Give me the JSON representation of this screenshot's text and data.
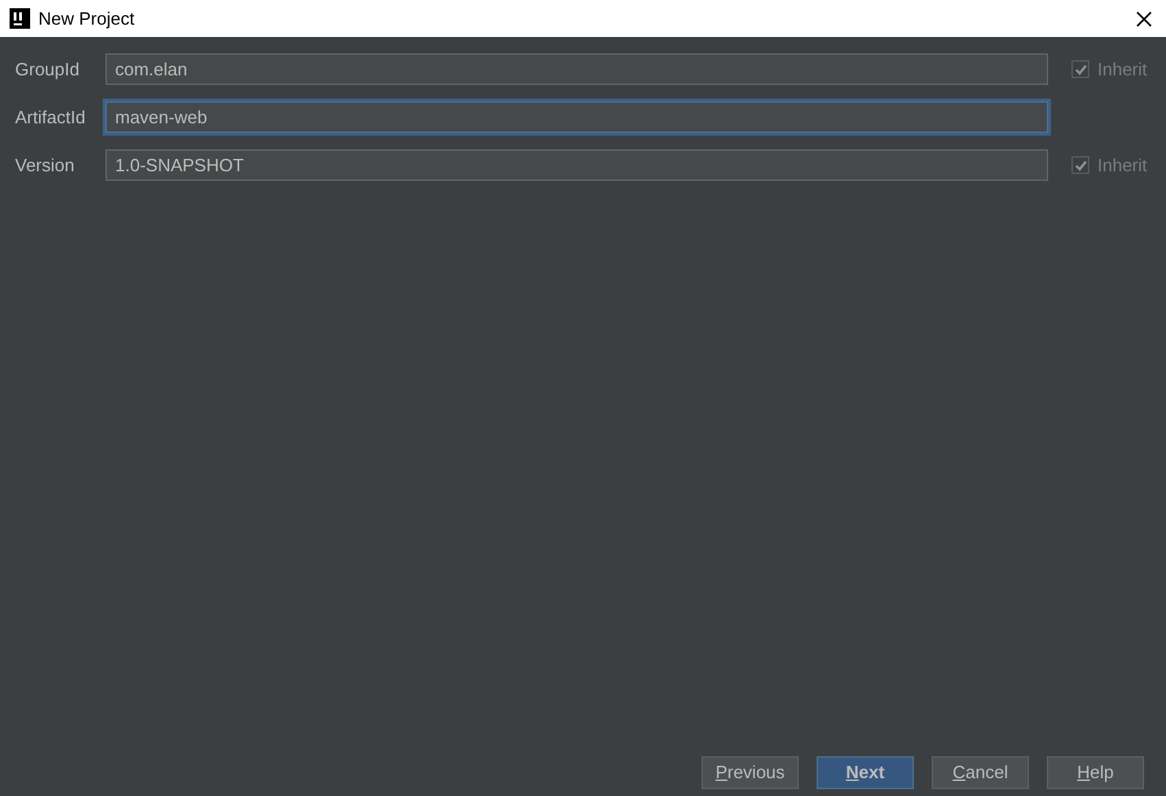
{
  "window": {
    "title": "New Project"
  },
  "fields": [
    {
      "label": "GroupId",
      "value": "com.elan",
      "focused": false,
      "inherit": {
        "label": "Inherit",
        "checked": true,
        "disabled": true
      }
    },
    {
      "label": "ArtifactId",
      "value": "maven-web",
      "focused": true
    },
    {
      "label": "Version",
      "value": "1.0-SNAPSHOT",
      "focused": false,
      "inherit": {
        "label": "Inherit",
        "checked": true,
        "disabled": true
      }
    }
  ],
  "buttons": [
    {
      "label": "Previous",
      "default": false
    },
    {
      "label": "Next",
      "default": true
    },
    {
      "label": "Cancel",
      "default": false
    },
    {
      "label": "Help",
      "default": false
    }
  ]
}
